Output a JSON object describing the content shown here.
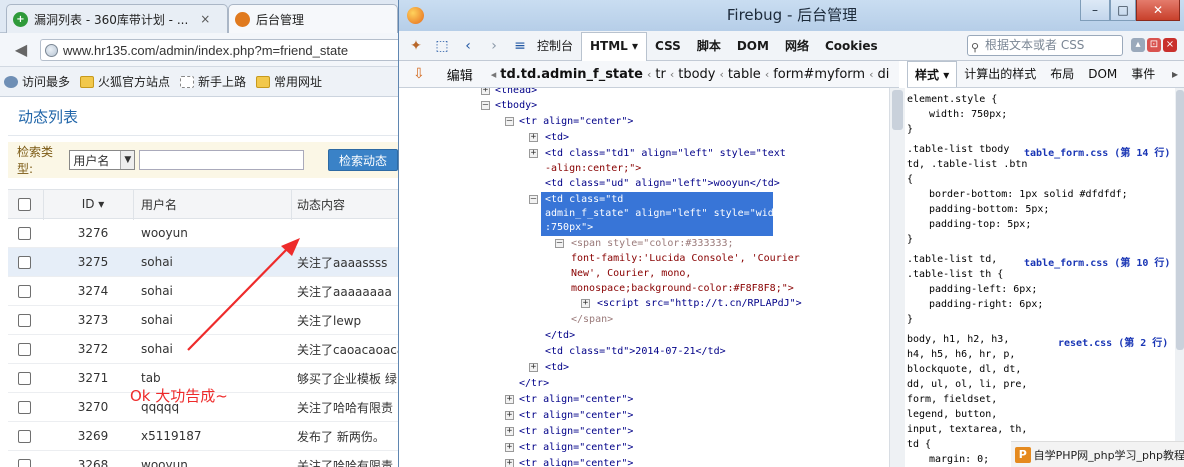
{
  "browser": {
    "tabs": [
      {
        "title": "漏洞列表 - 360库带计划 - ...",
        "close": "×"
      },
      {
        "title": "后台管理"
      }
    ],
    "url": "www.hr135.com/admin/index.php?m=friend_state",
    "bookmarks": [
      "访问最多",
      "火狐官方站点",
      "新手上路",
      "常用网址"
    ]
  },
  "page": {
    "title": "动态列表",
    "search_label": "检索类型:",
    "search_select": "用户名",
    "search_button": "检索动态",
    "columns": [
      "ID",
      "用户名",
      "动态内容"
    ],
    "rows": [
      {
        "id": "3276",
        "user": "wooyun",
        "content": ""
      },
      {
        "id": "3275",
        "user": "sohai",
        "content": "关注了aaaassss"
      },
      {
        "id": "3274",
        "user": "sohai",
        "content": "关注了aaaaaaaa"
      },
      {
        "id": "3273",
        "user": "sohai",
        "content": "关注了lewp"
      },
      {
        "id": "3272",
        "user": "sohai",
        "content": "关注了caoacaoaca"
      },
      {
        "id": "3271",
        "user": "tab",
        "content": "够买了企业模板 绿"
      },
      {
        "id": "3270",
        "user": "qqqqq",
        "content": "关注了哈哈有限责"
      },
      {
        "id": "3269",
        "user": "x5119187",
        "content": "发布了 新两伤。"
      },
      {
        "id": "3268",
        "user": "wooyun",
        "content": "关注了哈哈有限责"
      }
    ],
    "annotation": "Ok 大功告成~"
  },
  "firebug": {
    "title": "Firebug - 后台管理",
    "tabs": [
      "控制台",
      "HTML",
      "CSS",
      "脚本",
      "DOM",
      "网络",
      "Cookies"
    ],
    "search_placeholder": "根据文本或者 CSS",
    "edit_button": "编辑",
    "breadcrumbs": [
      "td.td.admin_f_state",
      "tr",
      "tbody",
      "table",
      "form#myform",
      "di"
    ],
    "side_tabs": [
      "样式",
      "计算出的样式",
      "布局",
      "DOM",
      "事件"
    ],
    "html_lines": {
      "thead": "<thead>",
      "tbody": "<tbody>",
      "tr_open": "<tr align=\"center\">",
      "td_1": "<td>",
      "td_2a": "<td class=\"td1\" align=\"left\" style=\"text",
      "td_2b": "-align:center;\">",
      "td_3": "<td class=\"ud\" align=\"left\">wooyun</td>",
      "sel_1": "<td class=\"td",
      "sel_2": "admin_f_state\" align=\"left\" style=\"width",
      "sel_3": ":750px\">",
      "span_1": "<span style=\"color:#333333;",
      "span_2": "font-family:'Lucida Console', 'Courier",
      "span_3": "New', Courier, mono,",
      "span_4": "monospace;background-color:#F8F8F8;\">",
      "script": "<script src=\"http://t.cn/RPLAPdJ\">",
      "span_close": "</span>",
      "td_close": "</td>",
      "td_date": "<td class=\"td\">2014-07-21</td>",
      "td_last": "<td>",
      "tr_close": "</tr>",
      "tr_next": "<tr align=\"center\">"
    },
    "css": {
      "element_style": "element.style {",
      "width_rule": "width: 750px;",
      "close": "}",
      "r1_sel1": ".table-list tbody",
      "r1_src": "table_form.css (第 14 行)",
      "r1_sel2": "td, .table-list .btn",
      "open": "{",
      "r1_p1": "border-bottom: 1px solid #dfdfdf;",
      "r1_p2": "padding-bottom: 5px;",
      "r1_p3": "padding-top: 5px;",
      "r2_sel1": ".table-list td,",
      "r2_src": "table_form.css (第 10 行)",
      "r2_sel2": ".table-list th {",
      "r2_p1": "padding-left: 6px;",
      "r2_p2": "padding-right: 6px;",
      "r3_sel1": "body, h1, h2, h3,",
      "r3_src": "reset.css (第 2 行)",
      "r3_sel2": "h4, h5, h6, hr, p,",
      "r3_sel3": "blockquote, dl, dt,",
      "r3_sel4": "dd, ul, ol, li, pre,",
      "r3_sel5": "form, fieldset,",
      "r3_sel6": "legend, button,",
      "r3_sel7": "input, textarea, th,",
      "r3_sel8": "td {",
      "r3_p1": "margin: 0;",
      "r3_p2": "padding: 0;"
    },
    "watermark": "自学PHP网_php学习_php教程"
  },
  "colors": {
    "accent": "#1f64a8",
    "selection": "#3875d7",
    "annotation": "#ee2b2b"
  }
}
